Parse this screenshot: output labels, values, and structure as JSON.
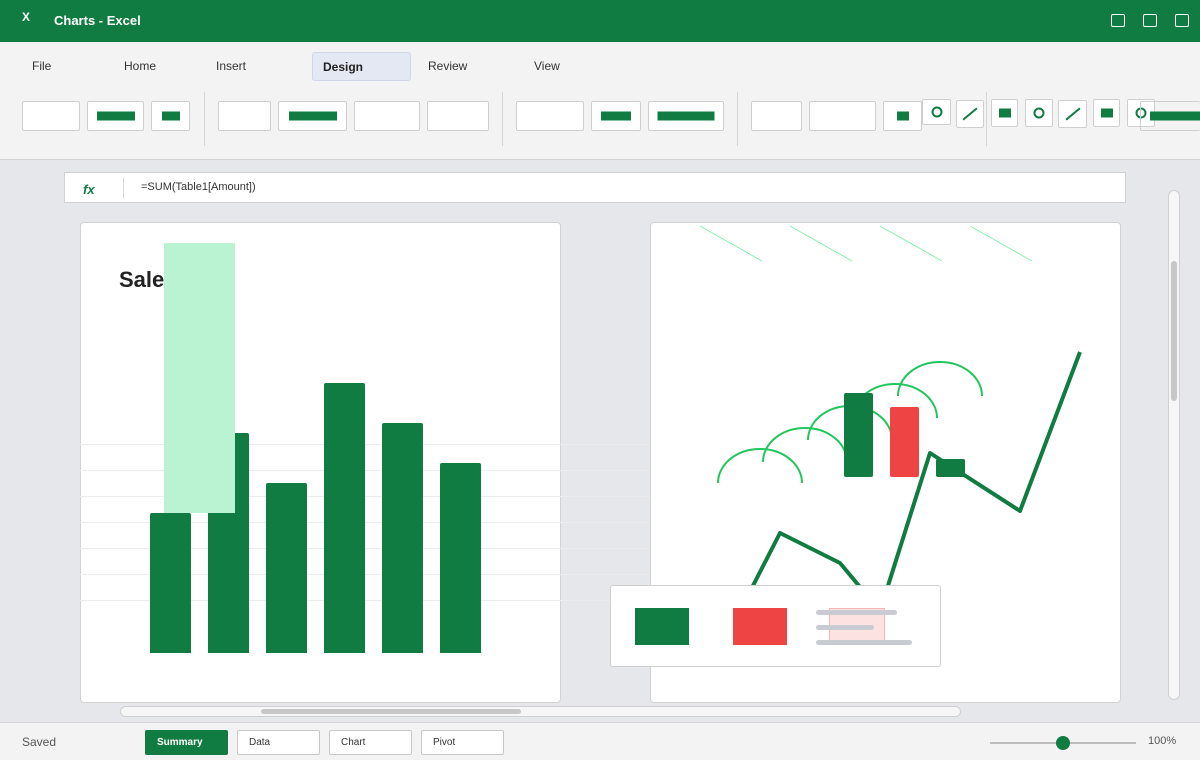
{
  "window": {
    "app_logo": "X",
    "title": "Charts - Excel"
  },
  "ribbon": {
    "tabs": [
      {
        "label": "File"
      },
      {
        "label": "Home"
      },
      {
        "label": "Insert"
      },
      {
        "label": "Design"
      },
      {
        "label": "Review"
      },
      {
        "label": "View"
      }
    ],
    "active_tab": "Design"
  },
  "formula_bar": {
    "fx_label": "fx",
    "formula": "=SUM(Table1[Amount])"
  },
  "bar_chart": {
    "title": "Sale",
    "chart_data": {
      "type": "bar",
      "title": "Sale",
      "series": [
        {
          "values": [
            140,
            220,
            170,
            270,
            230,
            190
          ]
        }
      ],
      "ylim": [
        0,
        270
      ],
      "grid": true
    }
  },
  "line_chart": {
    "chart_data": {
      "type": "line",
      "series": [
        {
          "values": [
            0,
            78,
            48,
            0,
            158,
            100,
            259
          ]
        }
      ]
    }
  },
  "status": {
    "text": "Saved",
    "zoom_label": "100%",
    "zoom_value": 0.5
  },
  "sheets": [
    {
      "label": "Summary",
      "active": true
    },
    {
      "label": "Data"
    },
    {
      "label": "Chart"
    },
    {
      "label": "Pivot"
    }
  ],
  "colors": {
    "accent": "#107c41",
    "negative": "#ef4444",
    "light_accent": "#b9f3d2",
    "curve": "#22c55e"
  }
}
